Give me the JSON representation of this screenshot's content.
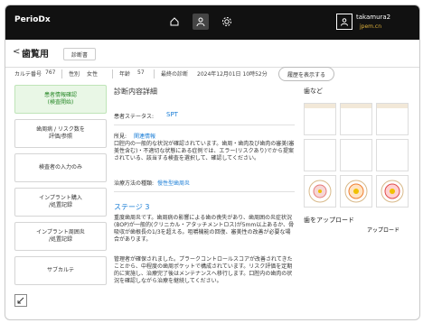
{
  "app": {
    "brand": "PerioDx"
  },
  "user": {
    "name": "takamura2",
    "sub": "jpem.cn"
  },
  "header": {
    "back_glyph": "<",
    "title": "歯覧用",
    "badge_label": "診断書"
  },
  "info": {
    "karute_label": "カルテ番号",
    "karute_value": "767",
    "sex_label": "性別",
    "sex_value": "女性",
    "age_label": "年齢",
    "age_value": "57",
    "last_label": "最終の診断",
    "last_value": "2024年12月01日 10時52分",
    "show_button_label": "履歴を表示する"
  },
  "sidebar": {
    "items": [
      {
        "label": "患者情報確認\n(検査開始)",
        "active": true
      },
      {
        "label": "歯周病 / リスク数を\n評価/参照",
        "active": false
      },
      {
        "label": "検査者の入力のみ",
        "active": false
      },
      {
        "label": "インプラント購入\n/処置記録",
        "active": false
      },
      {
        "label": "インプラント周囲炎\n/処置記録",
        "active": false
      },
      {
        "label": "サブカルテ",
        "active": false
      }
    ]
  },
  "main": {
    "heading": "診断内容詳細",
    "status_label": "患者ステータス:",
    "status_value": "SPT",
    "notes_label": "所見:",
    "notes_link": "関連情報",
    "notes_text": "口腔内の一般的な状況が確認されています。歯周・歯肉及び歯肉の審美(審美性含む)・不適切な状態にある症例では、エラー(リスクあり)でから提案されている、該当する検査を選択して、確認してください。",
    "diagnosis_label": "治療方法の種類:",
    "diagnosis_link": "慢性型歯周炎",
    "stage_title": "ステージ 3",
    "para1": "重度歯周炎です。歯周病の影響による歯の喪失があり、歯周囲の炎症状況(BOP)が一般的(クリニカル・アタッチメントロス)が5mm以上あるか、骨吸収が歯根長の1/3を超える。咀嚼機能の回復、審美性の改善が必要な場合があります。",
    "para2": "管理者が確保されました。プラークコントロールスコアが改善されてきたことから、中程度の歯周ポケットで構成されています。リスク評価を定期的に実施し、治療完了後はメンテナンスへ移行します。口腔内の歯肉の状況を確認しながら治療を継続してください。"
  },
  "right": {
    "teeth_title": "歯など",
    "upload_title": "歯をアップロード",
    "upload_link": "アップロード"
  },
  "colors": {
    "topbar": "#111111",
    "active_bg": "#e9f7e6",
    "active_text": "#2a8a2a",
    "link": "#1a7dd6",
    "accent_gold": "#e0b23c"
  }
}
